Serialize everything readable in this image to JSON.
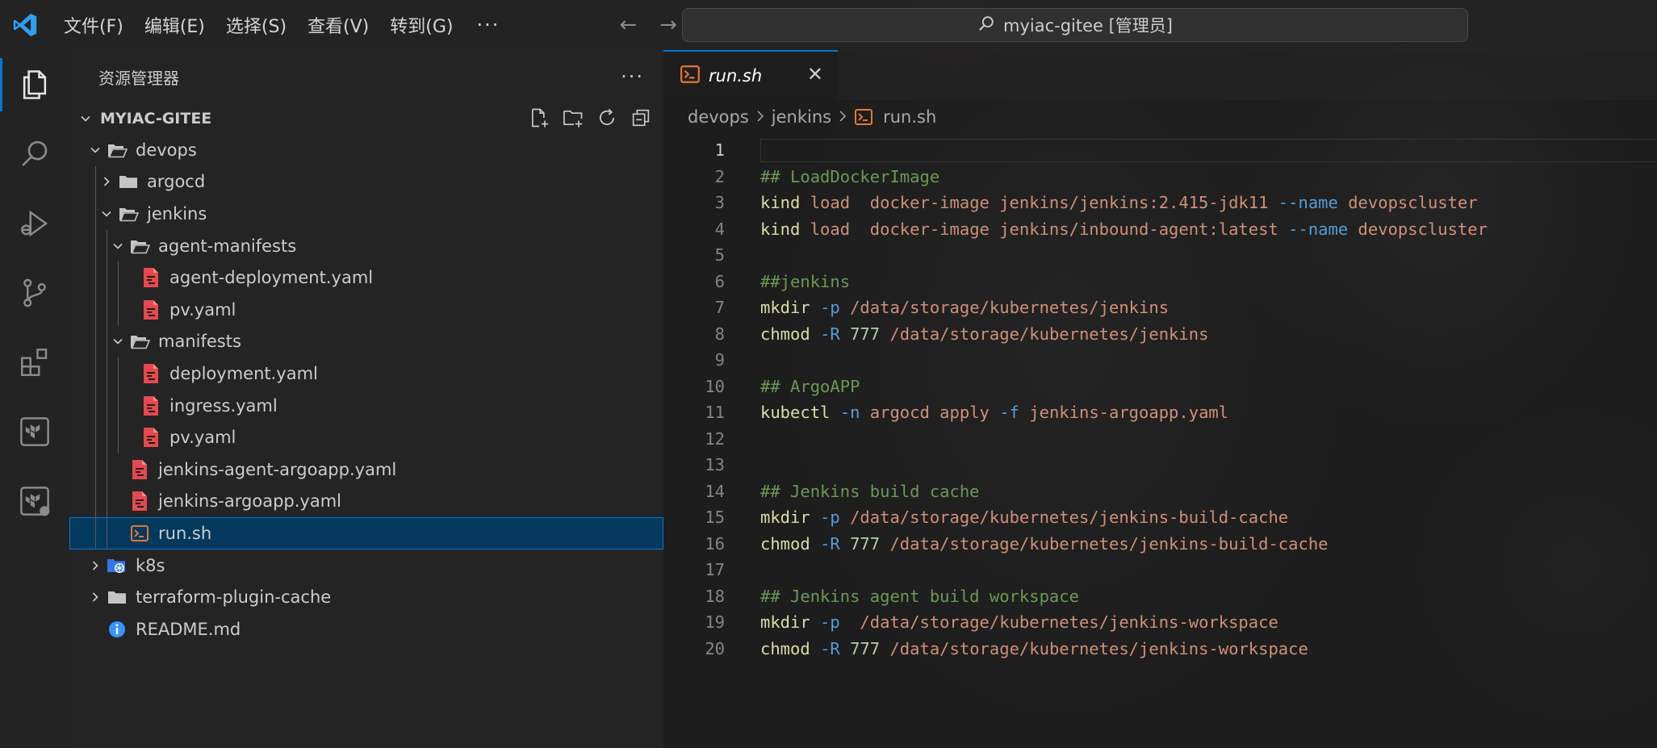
{
  "titlebar": {
    "menus": [
      "文件(F)",
      "编辑(E)",
      "选择(S)",
      "查看(V)",
      "转到(G)"
    ],
    "more": "···",
    "back_arrow": "←",
    "forward_arrow": "→",
    "search_text": "myiac-gitee [管理员]"
  },
  "activity_bar": {
    "items": [
      "explorer-icon",
      "search-icon",
      "run-debug-icon",
      "source-control-icon",
      "extensions-icon",
      "terraform-icon",
      "terraform-cloud-icon"
    ],
    "active": "explorer-icon"
  },
  "sidebar": {
    "title": "资源管理器",
    "more": "···",
    "section_title": "MYIAC-GITEE",
    "tree": [
      {
        "label": "devops",
        "depth": 0,
        "type": "folder",
        "expanded": true
      },
      {
        "label": "argocd",
        "depth": 1,
        "type": "folder",
        "expanded": false
      },
      {
        "label": "jenkins",
        "depth": 1,
        "type": "folder",
        "expanded": true
      },
      {
        "label": "agent-manifests",
        "depth": 2,
        "type": "folder",
        "expanded": true
      },
      {
        "label": "agent-deployment.yaml",
        "depth": 3,
        "type": "yaml"
      },
      {
        "label": "pv.yaml",
        "depth": 3,
        "type": "yaml"
      },
      {
        "label": "manifests",
        "depth": 2,
        "type": "folder",
        "expanded": true
      },
      {
        "label": "deployment.yaml",
        "depth": 3,
        "type": "yaml"
      },
      {
        "label": "ingress.yaml",
        "depth": 3,
        "type": "yaml"
      },
      {
        "label": "pv.yaml",
        "depth": 3,
        "type": "yaml"
      },
      {
        "label": "jenkins-agent-argoapp.yaml",
        "depth": 2,
        "type": "yaml"
      },
      {
        "label": "jenkins-argoapp.yaml",
        "depth": 2,
        "type": "yaml"
      },
      {
        "label": "run.sh",
        "depth": 2,
        "type": "shell",
        "selected": true
      },
      {
        "label": "k8s",
        "depth": 0,
        "type": "k8s-folder",
        "expanded": false
      },
      {
        "label": "terraform-plugin-cache",
        "depth": 0,
        "type": "folder",
        "expanded": false
      },
      {
        "label": "README.md",
        "depth": 0,
        "type": "info"
      }
    ]
  },
  "editor": {
    "tab_label": "run.sh",
    "tab_close": "✕",
    "breadcrumb": [
      "devops",
      "jenkins",
      "run.sh"
    ],
    "current_line": 1,
    "lines": [
      [],
      [
        [
          "cmt",
          "## LoadDockerImage"
        ]
      ],
      [
        [
          "cmd",
          "kind"
        ],
        [
          "str",
          " load  docker-image jenkins/jenkins:2.415-jdk11 "
        ],
        [
          "opt",
          "--name"
        ],
        [
          "str",
          " devopscluster"
        ]
      ],
      [
        [
          "cmd",
          "kind"
        ],
        [
          "str",
          " load  docker-image jenkins/inbound-agent:latest "
        ],
        [
          "opt",
          "--name"
        ],
        [
          "str",
          " devopscluster"
        ]
      ],
      [],
      [
        [
          "cmt",
          "##jenkins"
        ]
      ],
      [
        [
          "cmd",
          "mkdir"
        ],
        [
          "txt",
          " "
        ],
        [
          "opt",
          "-p"
        ],
        [
          "str",
          " /data/storage/kubernetes/jenkins"
        ]
      ],
      [
        [
          "cmd",
          "chmod"
        ],
        [
          "txt",
          " "
        ],
        [
          "opt",
          "-R"
        ],
        [
          "txt",
          " "
        ],
        [
          "num",
          "777"
        ],
        [
          "str",
          " /data/storage/kubernetes/jenkins"
        ]
      ],
      [],
      [
        [
          "cmt",
          "## ArgoAPP"
        ]
      ],
      [
        [
          "cmd",
          "kubectl"
        ],
        [
          "txt",
          " "
        ],
        [
          "opt",
          "-n"
        ],
        [
          "str",
          " argocd apply "
        ],
        [
          "opt",
          "-f"
        ],
        [
          "str",
          " jenkins-argoapp.yaml"
        ]
      ],
      [],
      [],
      [
        [
          "cmt",
          "## Jenkins build cache"
        ]
      ],
      [
        [
          "cmd",
          "mkdir"
        ],
        [
          "txt",
          " "
        ],
        [
          "opt",
          "-p"
        ],
        [
          "str",
          " /data/storage/kubernetes/jenkins-build-cache"
        ]
      ],
      [
        [
          "cmd",
          "chmod"
        ],
        [
          "txt",
          " "
        ],
        [
          "opt",
          "-R"
        ],
        [
          "txt",
          " "
        ],
        [
          "num",
          "777"
        ],
        [
          "str",
          " /data/storage/kubernetes/jenkins-build-cache"
        ]
      ],
      [],
      [
        [
          "cmt",
          "## Jenkins agent build workspace"
        ]
      ],
      [
        [
          "cmd",
          "mkdir"
        ],
        [
          "txt",
          " "
        ],
        [
          "opt",
          "-p"
        ],
        [
          "str",
          "  /data/storage/kubernetes/jenkins-workspace"
        ]
      ],
      [
        [
          "cmd",
          "chmod"
        ],
        [
          "txt",
          " "
        ],
        [
          "opt",
          "-R"
        ],
        [
          "txt",
          " "
        ],
        [
          "num",
          "777"
        ],
        [
          "str",
          " /data/storage/kubernetes/jenkins-workspace"
        ]
      ]
    ]
  },
  "colors": {
    "accent": "#0078d4",
    "yaml_icon": "#e5484d",
    "shell_icon": "#e37933",
    "folder_icon": "#c5c5c5",
    "info_icon": "#3794ff",
    "k8s_icon": "#3277e6"
  }
}
